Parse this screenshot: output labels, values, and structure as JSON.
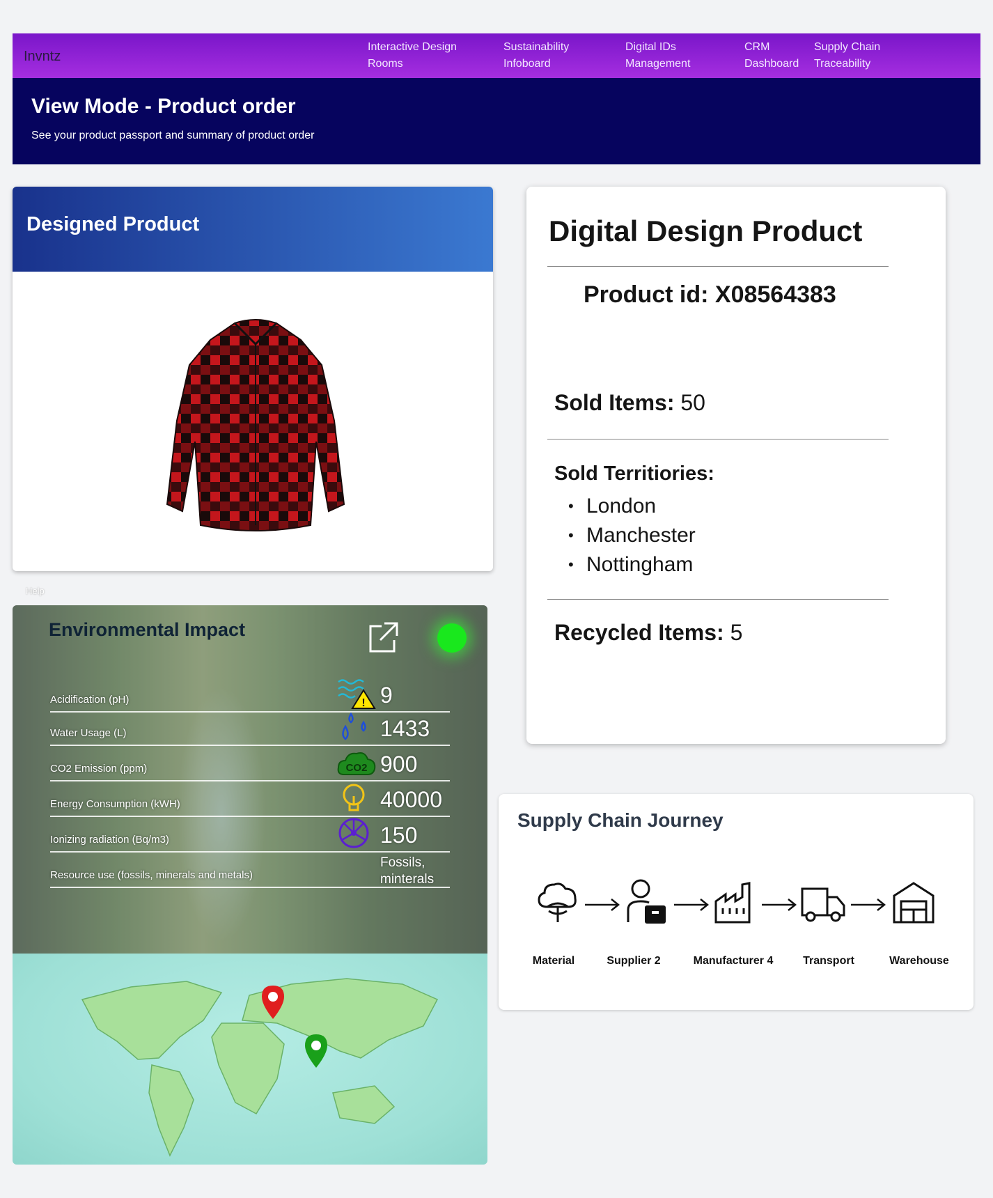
{
  "nav": {
    "brand": "Invntz",
    "links": [
      {
        "label": "Interactive Design\nRooms"
      },
      {
        "label": "Sustainability\nInfoboard"
      },
      {
        "label": "Digital IDs\nManagement"
      },
      {
        "label": "CRM\nDashboard"
      },
      {
        "label": "Supply Chain\nTraceability"
      }
    ]
  },
  "header": {
    "title": "View Mode - Product order",
    "subtitle": "See your product passport and summary of product order"
  },
  "designed_product": {
    "title": "Designed Product",
    "image_icon": "plaid-shirt"
  },
  "help_label": "Help",
  "environmental": {
    "title": "Environmental Impact",
    "status_color": "#19e81d",
    "rows": [
      {
        "label": "Acidification (pH)",
        "value": "9",
        "icon": "acid-warning-icon"
      },
      {
        "label": "Water Usage (L)",
        "value": "1433",
        "icon": "water-drops-icon"
      },
      {
        "label": "CO2 Emission (ppm)",
        "value": "900",
        "icon": "co2-cloud-icon"
      },
      {
        "label": "Energy Consumption (kWH)",
        "value": "40000",
        "icon": "bulb-icon"
      },
      {
        "label": "Ionizing radiation (Bq/m3)",
        "value": "150",
        "icon": "radiation-icon"
      },
      {
        "label": "Resource use (fossils, minerals and metals)",
        "value": "Fossils,\nminterals",
        "icon": ""
      }
    ]
  },
  "product": {
    "title": "Digital Design Product",
    "id_label": "Product id:",
    "id_value": "X08564383",
    "sold_label": "Sold Items:",
    "sold_value": "50",
    "territories_label": "Sold Territiories:",
    "territories": [
      "London",
      "Manchester",
      "Nottingham"
    ],
    "recycled_label": "Recycled Items:",
    "recycled_value": "5"
  },
  "supply_chain": {
    "title": "Supply Chain Journey",
    "steps": [
      {
        "label": "Material",
        "icon": "cotton-icon"
      },
      {
        "label": "Supplier 2",
        "icon": "supplier-icon"
      },
      {
        "label": "Manufacturer 4",
        "icon": "factory-icon"
      },
      {
        "label": "Transport",
        "icon": "truck-icon"
      },
      {
        "label": "Warehouse",
        "icon": "warehouse-icon"
      }
    ]
  },
  "colors": {
    "nav_gradient_start": "#7a16c9",
    "banner": "#06045e",
    "card_header_start": "#19328c",
    "card_header_end": "#3b79d1"
  }
}
